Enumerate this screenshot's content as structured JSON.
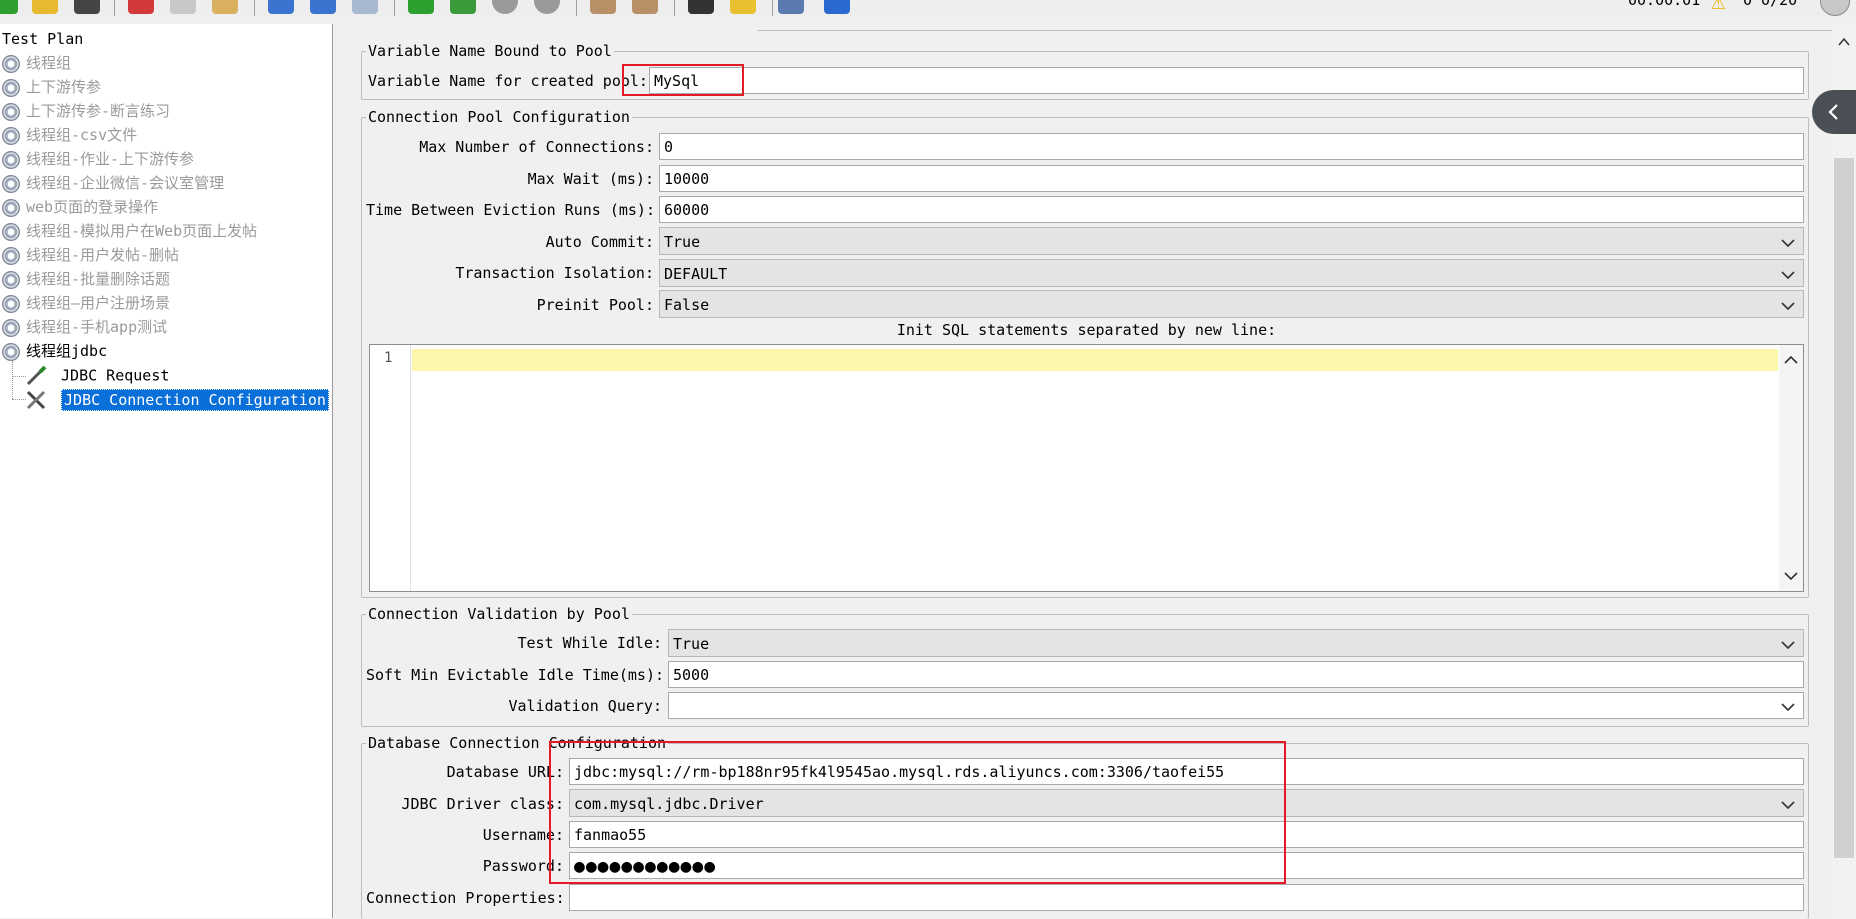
{
  "toolbar": {
    "timer": "00:00:01",
    "counts": "0  0/20"
  },
  "tree": {
    "root": "Test Plan",
    "items": [
      {
        "label": "线程组",
        "disabled": true
      },
      {
        "label": "上下游传参",
        "disabled": true
      },
      {
        "label": "上下游传参-断言练习",
        "disabled": true
      },
      {
        "label": "线程组-csv文件",
        "disabled": true
      },
      {
        "label": "线程组-作业-上下游传参",
        "disabled": true
      },
      {
        "label": "线程组-企业微信-会议室管理",
        "disabled": true
      },
      {
        "label": "web页面的登录操作",
        "disabled": true
      },
      {
        "label": "线程组-模拟用户在Web页面上发帖",
        "disabled": true
      },
      {
        "label": "线程组-用户发帖-删帖",
        "disabled": true
      },
      {
        "label": "线程组-批量删除话题",
        "disabled": true
      },
      {
        "label": "线程组—用户注册场景",
        "disabled": true
      },
      {
        "label": "线程组-手机app测试",
        "disabled": true
      },
      {
        "label": "线程组jdbc",
        "disabled": false
      }
    ],
    "children": [
      {
        "label": "JDBC Request",
        "selected": false
      },
      {
        "label": "JDBC Connection Configuration",
        "selected": true
      }
    ]
  },
  "pool_binding": {
    "legend": "Variable Name Bound to Pool",
    "var_label": "Variable Name for created pool:",
    "var_value": "MySql"
  },
  "pool_config": {
    "legend": "Connection Pool Configuration",
    "max_conn_label": "Max Number of Connections:",
    "max_conn_value": "0",
    "max_wait_label": "Max Wait (ms):",
    "max_wait_value": "10000",
    "eviction_label": "Time Between Eviction Runs (ms):",
    "eviction_value": "60000",
    "auto_commit_label": "Auto Commit:",
    "auto_commit_value": "True",
    "isolation_label": "Transaction Isolation:",
    "isolation_value": "DEFAULT",
    "preinit_label": "Preinit Pool:",
    "preinit_value": "False",
    "init_sql_label": "Init SQL statements separated by new line:",
    "line_number": "1"
  },
  "validation": {
    "legend": "Connection Validation by Pool",
    "test_idle_label": "Test While Idle:",
    "test_idle_value": "True",
    "soft_min_label": "Soft Min Evictable Idle Time(ms):",
    "soft_min_value": "5000",
    "query_label": "Validation Query:",
    "query_value": ""
  },
  "database": {
    "legend": "Database Connection Configuration",
    "url_label": "Database URL:",
    "url_value": "jdbc:mysql://rm-bp188nr95fk4l9545ao.mysql.rds.aliyuncs.com:3306/taofei55",
    "driver_label": "JDBC Driver class:",
    "driver_value": "com.mysql.jdbc.Driver",
    "username_label": "Username:",
    "username_value": "fanmao55",
    "password_label": "Password:",
    "password_mask": "●●●●●●●●●●●●",
    "props_label": "Connection Properties:",
    "props_value": ""
  },
  "colors": {
    "selection": "#0a6fd8",
    "highlight_line": "#fbf6a9",
    "annotation_red": "#e01b24"
  }
}
